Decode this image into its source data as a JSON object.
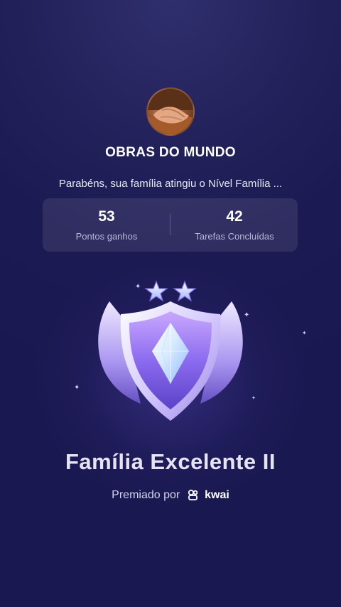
{
  "profile": {
    "name": "OBRAS DO MUNDO",
    "avatar_icon": "handshake-photo"
  },
  "message": "Parabéns, sua família atingiu o Nível Família ...",
  "stats": [
    {
      "value": "53",
      "label": "Pontos ganhos"
    },
    {
      "value": "42",
      "label": "Tarefas Concluídas"
    }
  ],
  "badge": {
    "name": "Família Excelente II",
    "stars": 2,
    "icon": "shield-crystal-badge-icon"
  },
  "awarded": {
    "prefix": "Premiado por",
    "brand": "kwai",
    "brand_icon": "kwai-logo-icon"
  },
  "colors": {
    "background": "#1f1d56",
    "text": "#ffffff",
    "muted": "#b9b8d8",
    "badge_accent": "#b79cff"
  }
}
